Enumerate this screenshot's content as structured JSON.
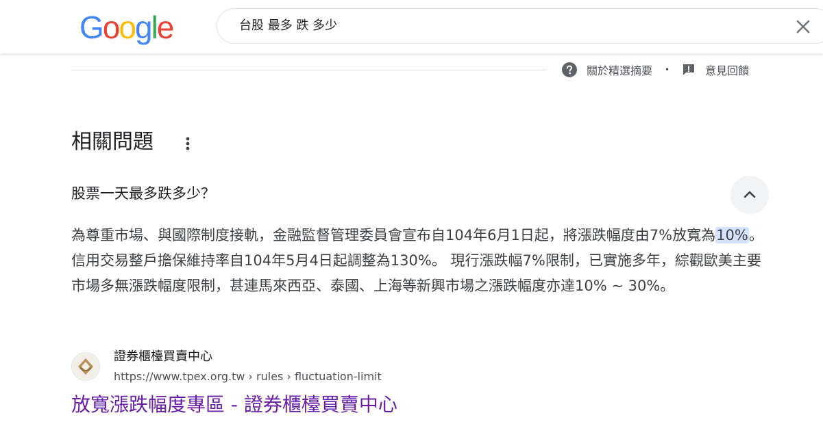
{
  "header": {
    "logo_text": "Google",
    "logo_colors": [
      "#4285F4",
      "#EA4335",
      "#FBBC05",
      "#4285F4",
      "#34A853",
      "#EA4335"
    ],
    "search_query": "台股 最多 跌 多少",
    "clear_icon": "close-icon"
  },
  "feedback": {
    "about_label": "關於精選摘要",
    "about_icon": "help-circle-icon",
    "separator": "•",
    "feedback_label": "意見回饋",
    "feedback_icon": "feedback-icon"
  },
  "related_questions": {
    "title": "相關問題",
    "more_icon": "more-vert-icon",
    "items": [
      {
        "question": "股票一天最多跌多少？",
        "expand_icon": "chevron-up-icon",
        "answer_before": "為尊重市場、與國際制度接軌，金融監督管理委員會宣布自104年6月1日起，將漲跌幅度由7%放寬為",
        "answer_highlight": "10%",
        "answer_after": "。 信用交易整戶擔保維持率自104年5月4日起調整為130%。 現行漲跌幅7%限制，已實施多年，綜觀歐美主要市場多無漲跌幅度限制，甚連馬來西亞、泰國、上海等新興市場之漲跌幅度亦達10% ~ 30%。",
        "source": {
          "name": "證券櫃檯買賣中心",
          "url": "https://www.tpex.org.tw › rules › fluctuation-limit",
          "title": "放寬漲跌幅度專區 - 證券櫃檯買賣中心",
          "link_color": "#681da8"
        }
      }
    ]
  }
}
